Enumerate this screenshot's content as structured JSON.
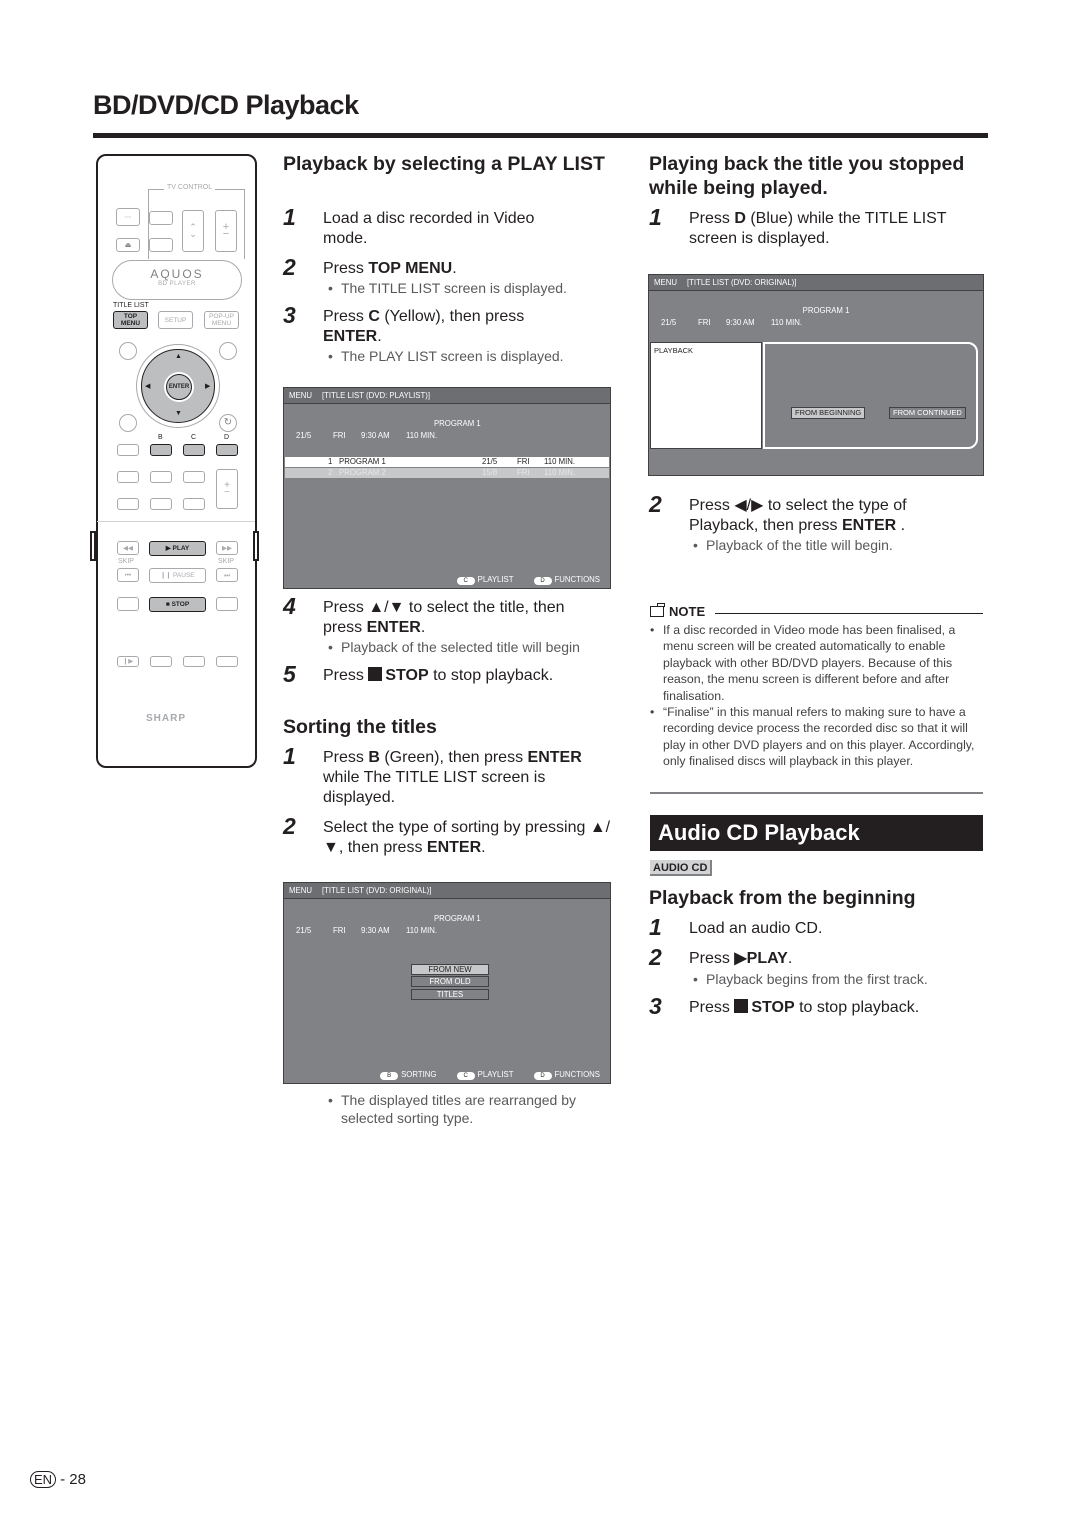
{
  "page": {
    "title": "BD/DVD/CD Playback",
    "page_badge": "EN",
    "page_number": "- 28"
  },
  "remote": {
    "tv_control_label": "TV CONTROL",
    "brand_name": "AQUOS",
    "brand_sub": "BD PLAYER",
    "title_list_label": "TITLE LIST",
    "top_menu_label": "TOP MENU",
    "setup_label": "SETUP",
    "popup_menu_label": "POP-UP MENU",
    "enter_label": "ENTER",
    "color_keys": [
      "B",
      "C",
      "D"
    ],
    "play_label": "▶ PLAY",
    "pause_label": "❙❙ PAUSE",
    "stop_label": "■ STOP",
    "skip_label": "SKIP",
    "maker": "SHARP"
  },
  "left_section": {
    "heading": "Playback by selecting a PLAY LIST",
    "steps": [
      {
        "num": "1",
        "text": "Load a disc recorded in Video mode."
      },
      {
        "num": "2",
        "pre": "Press ",
        "bold": "TOP MENU",
        "post": ".",
        "bullet": "The TITLE LIST screen is displayed."
      },
      {
        "num": "3",
        "pre": "Press ",
        "bold": "C",
        "mid": " (Yellow), then press ",
        "bold2": "ENTER",
        "post": ".",
        "bullet": "The PLAY LIST screen is displayed."
      },
      {
        "num": "4",
        "pre": "Press ▲/▼ to select the title, then press ",
        "bold": "ENTER",
        "post": ".",
        "bullet": "Playback of the selected title will begin"
      },
      {
        "num": "5",
        "pre": "Press ",
        "bold": "STOP",
        "post": " to stop playback."
      }
    ],
    "screen": {
      "menu": "MENU",
      "header": "[TITLE LIST (DVD: PLAYLIST)]",
      "program": "PROGRAM 1",
      "info": [
        "21/5",
        "FRI",
        "9:30 AM",
        "110 MIN."
      ],
      "rows": [
        {
          "no": "1",
          "name": "PROGRAM 1",
          "date": "21/5",
          "day": "FRI",
          "len": "110 MIN.",
          "selected": true
        },
        {
          "no": "2",
          "name": "PROGRAM 2",
          "date": "15/8",
          "day": "FRI",
          "len": "110 MIN.",
          "selected": false
        }
      ],
      "legend": [
        {
          "key": "C",
          "label": "PLAYLIST"
        },
        {
          "key": "D",
          "label": "FUNCTIONS"
        }
      ]
    }
  },
  "sorting_section": {
    "heading": "Sorting the titles",
    "steps": [
      {
        "num": "1",
        "pre": "Press ",
        "bold": "B",
        "mid": " (Green), then press ",
        "bold2": "ENTER",
        "post": " while The TITLE LIST screen is displayed."
      },
      {
        "num": "2",
        "pre": "Select the type of sorting by pressing ▲/▼, then press ",
        "bold": "ENTER",
        "post": "."
      }
    ],
    "screen": {
      "menu": "MENU",
      "header": "[TITLE LIST (DVD: ORIGINAL)]",
      "program": "PROGRAM 1",
      "info": [
        "21/5",
        "FRI",
        "9:30 AM",
        "110 MIN."
      ],
      "options": [
        {
          "label": "FROM NEW",
          "selected": true
        },
        {
          "label": "FROM OLD",
          "selected": false
        },
        {
          "label": "TITLES",
          "selected": false
        }
      ],
      "legend": [
        {
          "key": "B",
          "label": "SORTING"
        },
        {
          "key": "C",
          "label": "PLAYLIST"
        },
        {
          "key": "D",
          "label": "FUNCTIONS"
        }
      ]
    },
    "bullet": "The displayed titles are rearranged by selected sorting type."
  },
  "right_section": {
    "heading": "Playing back the title you stopped while being played.",
    "step1": {
      "num": "1",
      "pre": "Press ",
      "bold": "D",
      "post": " (Blue) while the TITLE LIST screen is displayed."
    },
    "screen": {
      "menu": "MENU",
      "header": "[TITLE LIST (DVD: ORIGINAL)]",
      "program": "PROGRAM 1",
      "info": [
        "21/5",
        "FRI",
        "9:30 AM",
        "110 MIN."
      ],
      "panel_label": "PLAYBACK",
      "options": [
        {
          "label": "FROM BEGINNING",
          "selected": true
        },
        {
          "label": "FROM CONTINUED",
          "selected": false
        }
      ]
    },
    "step2": {
      "num": "2",
      "pre": "Press ◀/▶ to select the type of Playback, then press ",
      "bold": "ENTER",
      "post": " .",
      "bullet": "Playback of the title will begin."
    },
    "note": {
      "title": "NOTE",
      "items": [
        "If a disc recorded in Video mode has been finalised, a menu screen will be created automatically to enable playback with other BD/DVD players. Because of this reason, the menu screen is different before and after finalisation.",
        "“Finalise” in this manual refers to making sure to have a recording device process the recorded disc so that it will play in other DVD players and on this player. Accordingly, only finalised discs will playback in this player."
      ]
    }
  },
  "audio_cd": {
    "section_title": "Audio CD Playback",
    "badge": "AUDIO CD",
    "heading": "Playback from the beginning",
    "steps": [
      {
        "num": "1",
        "text": "Load an audio CD."
      },
      {
        "num": "2",
        "pre": "Press ",
        "bold": "▶PLAY",
        "post": ".",
        "bullet": "Playback begins from the first track."
      },
      {
        "num": "3",
        "pre": "Press ",
        "bold": "STOP",
        "post": " to stop playback."
      }
    ]
  }
}
